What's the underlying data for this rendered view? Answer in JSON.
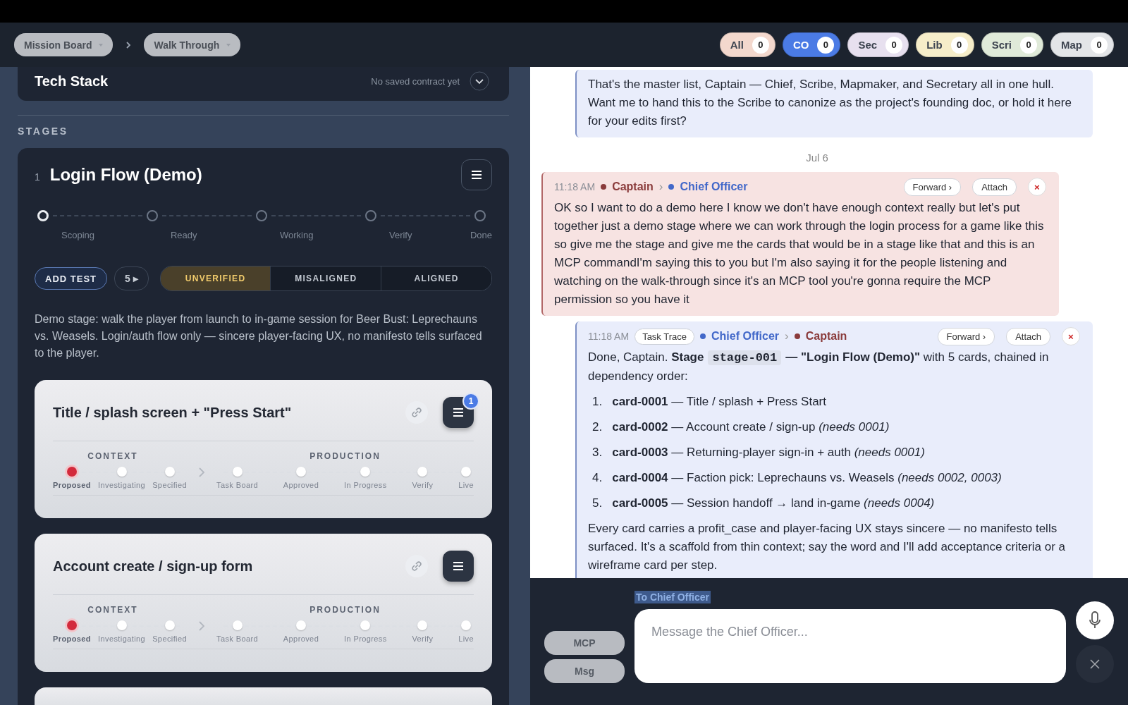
{
  "breadcrumbs": [
    {
      "label": "Mission Board"
    },
    {
      "label": "Walk Through"
    }
  ],
  "filters": [
    {
      "label": "All",
      "count": "0",
      "color": "#f3d8cd",
      "selected": false
    },
    {
      "label": "CO",
      "count": "0",
      "color": "#4b7be5",
      "selected": true
    },
    {
      "label": "Sec",
      "count": "0",
      "color": "#e7e0ef",
      "selected": false
    },
    {
      "label": "Lib",
      "count": "0",
      "color": "#f6edc9",
      "selected": false
    },
    {
      "label": "Scri",
      "count": "0",
      "color": "#e0ead9",
      "selected": false
    },
    {
      "label": "Map",
      "count": "0",
      "color": "#e3e5e8",
      "selected": false
    }
  ],
  "tech_stack": {
    "title": "Tech Stack",
    "status": "No saved contract yet"
  },
  "stages_heading": "STAGES",
  "stage": {
    "number": "1",
    "title": "Login Flow (Demo)",
    "steps": [
      {
        "label": "Scoping",
        "selected": true
      },
      {
        "label": "Ready",
        "selected": false
      },
      {
        "label": "Working",
        "selected": false
      },
      {
        "label": "Verify",
        "selected": false
      },
      {
        "label": "Done",
        "selected": false
      }
    ],
    "add_test": "ADD TEST",
    "test_count": "5 ▸",
    "verification": [
      {
        "label": "UNVERIFIED",
        "selected": true
      },
      {
        "label": "MISALIGNED",
        "selected": false
      },
      {
        "label": "ALIGNED",
        "selected": false
      }
    ],
    "description": "Demo stage: walk the player from launch to in-game session for Beer Bust: Leprechauns vs. Weasels. Login/auth flow only — sincere player-facing UX, no manifesto tells surfaced to the player."
  },
  "cards": [
    {
      "kind": "full",
      "title": "Title / splash screen + \"Press Start\"",
      "badge": "1",
      "groups": [
        {
          "label": "CONTEXT",
          "steps": [
            {
              "label": "Proposed",
              "selected": true
            },
            {
              "label": "Investigating",
              "selected": false
            },
            {
              "label": "Specified",
              "selected": false
            }
          ]
        },
        {
          "label": "PRODUCTION",
          "steps": [
            {
              "label": "Task Board",
              "selected": false
            },
            {
              "label": "Approved",
              "selected": false
            },
            {
              "label": "In Progress",
              "selected": false
            },
            {
              "label": "Verify",
              "selected": false
            },
            {
              "label": "Live",
              "selected": false
            }
          ]
        }
      ]
    },
    {
      "kind": "full",
      "title": "Account create / sign-up form",
      "groups": [
        {
          "label": "CONTEXT",
          "steps": [
            {
              "label": "Proposed",
              "selected": true
            },
            {
              "label": "Investigating",
              "selected": false
            },
            {
              "label": "Specified",
              "selected": false
            }
          ]
        },
        {
          "label": "PRODUCTION",
          "steps": [
            {
              "label": "Task Board",
              "selected": false
            },
            {
              "label": "Approved",
              "selected": false
            },
            {
              "label": "In Progress",
              "selected": false
            },
            {
              "label": "Verify",
              "selected": false
            },
            {
              "label": "Live",
              "selected": false
            }
          ]
        }
      ]
    },
    {
      "kind": "stub"
    }
  ],
  "messages": [
    {
      "kind": "agent_message",
      "body": [
        {
          "kind": "paragraph",
          "text": "That's the master list, Captain — Chief, Scribe, Mapmaker, and Secretary all in one hull. Want me to hand this to the Scribe to canonize as the project's founding doc, or hold it here for your edits first?"
        }
      ]
    },
    {
      "kind": "date",
      "text": "Jul 6"
    },
    {
      "kind": "captain_message",
      "time": "11:18 AM",
      "sender": {
        "name": "Captain",
        "color": "#8a3b3b"
      },
      "separator": "›",
      "recipient": {
        "name": "Chief Officer",
        "color": "#4268c9"
      },
      "actions": [
        "Forward ›",
        "Attach"
      ],
      "close": "×",
      "body": [
        {
          "kind": "paragraph",
          "text": "OK so I want to do a demo here I know we don't have enough context really but let's put together just a demo stage where we can work through the login process for a game like this so give me the stage and give me the cards that would be in a stage like that and this is an MCP commandI'm saying this to you but I'm also saying it for the people listening and watching on the walk-through since it's an MCP tool you're gonna require the MCP permission so you have it"
        }
      ]
    },
    {
      "kind": "agent_message",
      "time": "11:18 AM",
      "tag": "Task Trace",
      "sender": {
        "name": "Chief Officer",
        "color": "#4268c9"
      },
      "separator": "›",
      "recipient": {
        "name": "Captain",
        "color": "#8a3b3b"
      },
      "actions": [
        "Forward ›",
        "Attach"
      ],
      "close": "×",
      "body": [
        {
          "kind": "parts",
          "parts": [
            {
              "kind": "plain",
              "text": "Done, Captain. "
            },
            {
              "kind": "bold",
              "text": "Stage"
            },
            {
              "kind": "code",
              "text": "stage-001"
            },
            {
              "kind": "bold",
              "text": "— \"Login Flow (Demo)\""
            },
            {
              "kind": "plain",
              "text": " with 5 cards, chained in dependency order:"
            }
          ]
        },
        {
          "kind": "list",
          "items": [
            {
              "number": "1.",
              "text": "**card-0001** — Title / splash + Press Start"
            },
            {
              "number": "2.",
              "text": "**card-0002** — Account create / sign-up *(needs 0001)*"
            },
            {
              "number": "3.",
              "text": "**card-0003** — Returning-player sign-in + auth *(needs 0001)*"
            },
            {
              "number": "4.",
              "text": "**card-0004** — Faction pick: Leprechauns vs. Weasels *(needs 0002, 0003)*"
            },
            {
              "number": "5.",
              "text": "**card-0005** — Session handoff → land in-game *(needs 0004)*"
            }
          ]
        },
        {
          "kind": "paragraph",
          "text": "Every card carries a profit_case and player-facing UX stays sincere — no manifesto tells surfaced. It's a scaffold from thin context; say the word and I'll add acceptance criteria or a wireframe card per step."
        }
      ]
    }
  ],
  "composer": {
    "to": "To Chief Officer",
    "modes": [
      {
        "label": "MCP"
      },
      {
        "label": "Msg"
      }
    ],
    "placeholder": "Message the Chief Officer...",
    "cancel": {
      "disabled": true
    }
  }
}
